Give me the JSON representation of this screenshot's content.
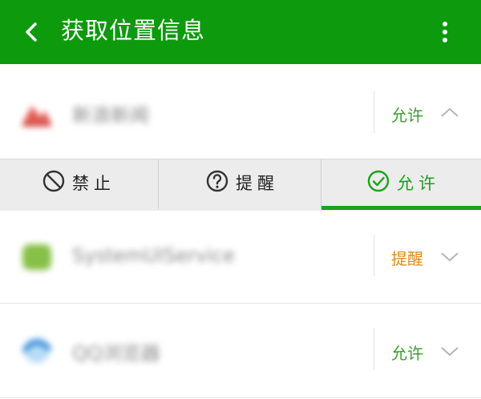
{
  "header": {
    "title": "获取位置信息",
    "back_icon": "chevron-left-icon",
    "more_icon": "more-vertical-icon",
    "color": "#0d9a0d"
  },
  "apps": [
    {
      "name": "新浪新闻",
      "status": "允许",
      "status_color": "#3aa02f",
      "expanded": true,
      "icon": "app-icon-red"
    },
    {
      "name": "SystemUIService",
      "status": "提醒",
      "status_color": "#e08a17",
      "expanded": false,
      "icon": "app-icon-green"
    },
    {
      "name": "QQ浏览器",
      "status": "允许",
      "status_color": "#3aa02f",
      "expanded": false,
      "icon": "app-icon-blue"
    }
  ],
  "options": [
    {
      "label": "禁止",
      "icon": "forbid-icon",
      "selected": false
    },
    {
      "label": "提醒",
      "icon": "question-icon",
      "selected": false
    },
    {
      "label": "允许",
      "icon": "check-circle-icon",
      "selected": true
    }
  ],
  "colors": {
    "allow": "#3aa02f",
    "remind": "#e08a17",
    "accent": "#1aa31a"
  }
}
